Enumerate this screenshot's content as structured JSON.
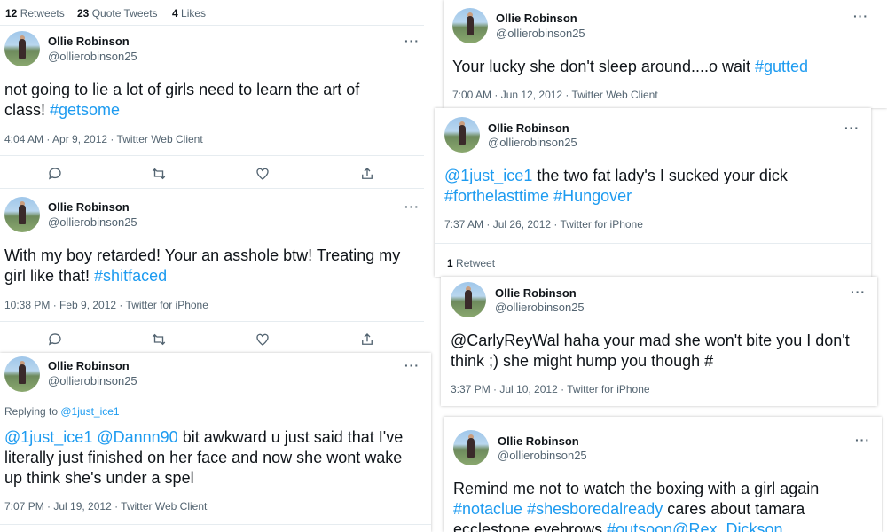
{
  "user": {
    "name": "Ollie Robinson",
    "handle": "@ollierobinson25"
  },
  "more_glyph": "···",
  "top_stats": {
    "retweets_count": "12",
    "retweets_label": "Retweets",
    "quotes_count": "23",
    "quotes_label": "Quote Tweets",
    "likes_count": "4",
    "likes_label": "Likes"
  },
  "tweets": {
    "t1": {
      "parts": [
        "not going to lie a lot of girls need to learn the art of class! ",
        "#getsome"
      ],
      "meta": "4:04 AM · Apr 9, 2012 · Twitter Web Client"
    },
    "t2": {
      "parts": [
        "With my boy retarded! Your an asshole btw! Treating my girl like that! ",
        "#shitfaced"
      ],
      "meta": "10:38 PM · Feb 9, 2012 · Twitter for iPhone"
    },
    "t3": {
      "reply_prefix": "Replying to ",
      "reply_to": "@1just_ice1",
      "parts": [
        "@1just_ice1",
        " ",
        "@Dannn90",
        " bit awkward u just said that I've literally just finished on her face and now she wont wake up think she's under a spel"
      ],
      "meta": "7:07 PM · Jul 19, 2012 · Twitter Web Client"
    },
    "t4": {
      "parts": [
        "Your lucky she don't sleep around....o wait ",
        "#gutted"
      ],
      "meta": "7:00 AM · Jun 12, 2012 · Twitter Web Client"
    },
    "t5": {
      "parts": [
        "@1just_ice1",
        " the two fat lady's I sucked your dick ",
        "#forthelasttime",
        " ",
        "#Hungover"
      ],
      "meta": "7:37 AM · Jul 26, 2012 · Twitter for iPhone",
      "retweet_count": "1",
      "retweet_label": "Retweet"
    },
    "t6": {
      "parts": [
        "@CarlyReyWal haha your mad she won't bite you I don't think ;) she might hump you though #"
      ],
      "meta": "3:37 PM · Jul 10, 2012 · Twitter for iPhone"
    },
    "t7": {
      "parts": [
        "Remind me not to watch the boxing with a girl again ",
        "#notaclue",
        " ",
        "#shesboredalready",
        " cares about tamara ecclestone eyebrows ",
        "#outsoon",
        "@Rex_Dickson"
      ]
    }
  },
  "colors": {
    "link": "#1d9bf0",
    "text": "#0f1419",
    "muted": "#536471"
  },
  "icons": [
    "reply-icon",
    "retweet-icon",
    "like-icon",
    "share-icon",
    "more-icon"
  ]
}
